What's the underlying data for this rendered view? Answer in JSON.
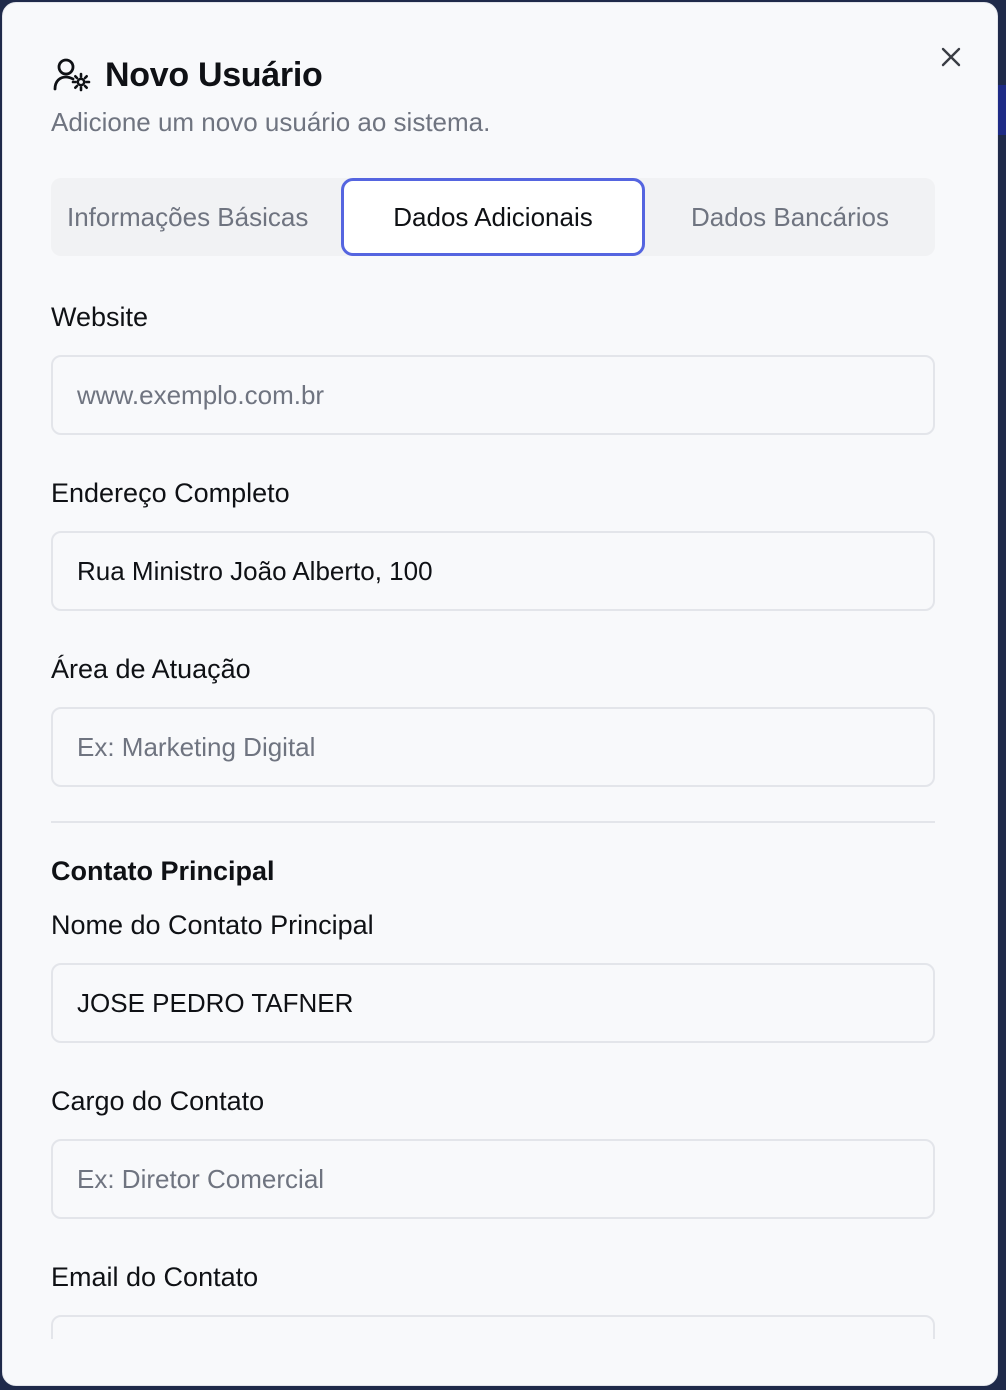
{
  "dialog": {
    "title": "Novo Usuário",
    "subtitle": "Adicione um novo usuário ao sistema.",
    "title_icon": "user-gear-icon",
    "close_icon": "close-icon"
  },
  "tabs": [
    {
      "label": "Informações Básicas",
      "active": false
    },
    {
      "label": "Dados Adicionais",
      "active": true
    },
    {
      "label": "Dados Bancários",
      "active": false
    }
  ],
  "form": {
    "website": {
      "label": "Website",
      "value": "",
      "placeholder": "www.exemplo.com.br"
    },
    "endereco": {
      "label": "Endereço Completo",
      "value": "Rua Ministro João Alberto, 100",
      "placeholder": ""
    },
    "area": {
      "label": "Área de Atuação",
      "value": "",
      "placeholder": "Ex: Marketing Digital"
    },
    "contato_section": "Contato Principal",
    "contato_nome": {
      "label": "Nome do Contato Principal",
      "value": "JOSE PEDRO TAFNER",
      "placeholder": ""
    },
    "contato_cargo": {
      "label": "Cargo do Contato",
      "value": "",
      "placeholder": "Ex: Diretor Comercial"
    },
    "contato_email": {
      "label": "Email do Contato",
      "value": "",
      "placeholder": ""
    }
  },
  "colors": {
    "accent": "#5565e0",
    "background": "#f8f9fb",
    "text": "#0f1115",
    "muted": "#6f7480"
  }
}
